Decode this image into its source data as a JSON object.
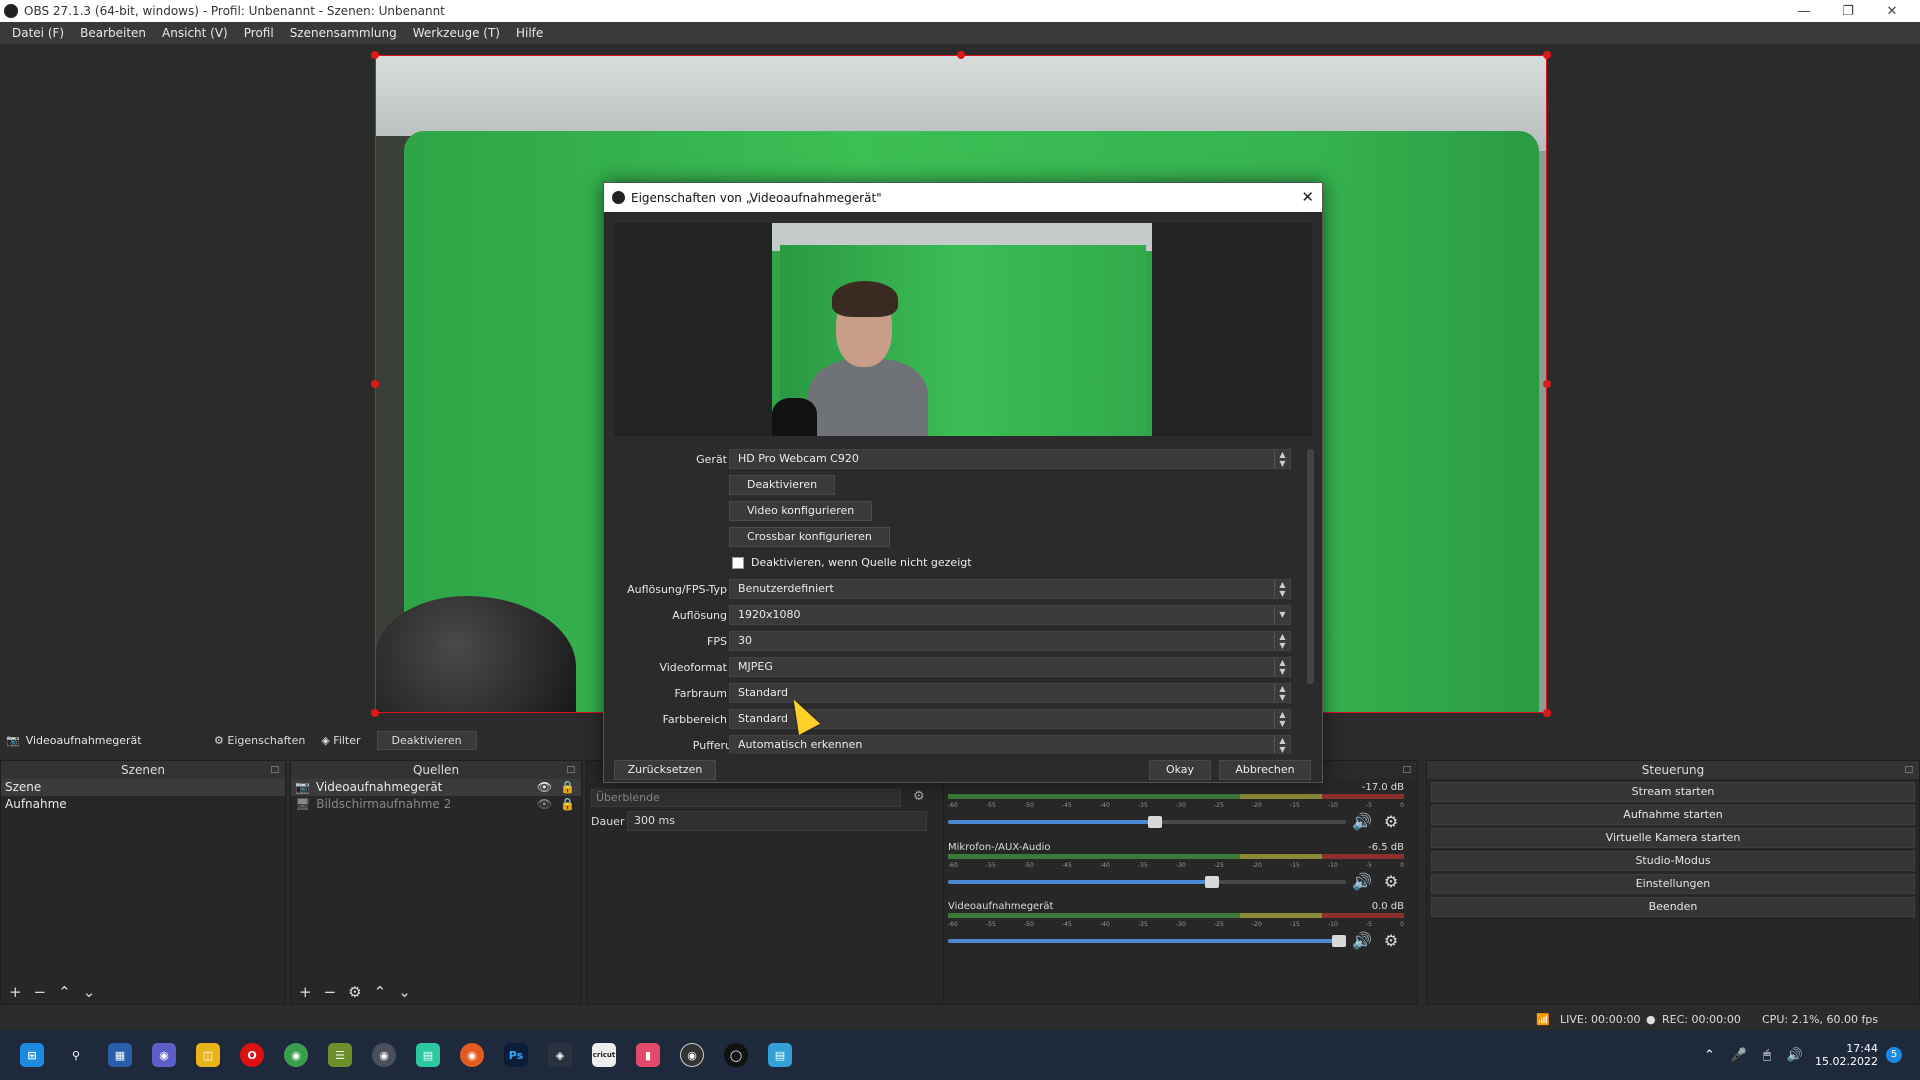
{
  "window": {
    "title": "OBS 27.1.3 (64-bit, windows) - Profil: Unbenannt - Szenen: Unbenannt",
    "min_icon": "minimize-icon",
    "max_icon": "restore-icon",
    "close_icon": "close-icon"
  },
  "menu": [
    "Datei (F)",
    "Bearbeiten",
    "Ansicht (V)",
    "Profil",
    "Szenensammlung",
    "Werkzeuge (T)",
    "Hilfe"
  ],
  "source_toolbar": {
    "source_name": "Videoaufnahmegerät",
    "properties": "Eigenschaften",
    "filter": "Filter",
    "deactivate": "Deaktivieren"
  },
  "scenes": {
    "title": "Szenen",
    "items": [
      "Szene",
      "Aufnahme"
    ]
  },
  "sources": {
    "title": "Quellen",
    "items": [
      "Videoaufnahmegerät",
      "Bildschirmaufnahme 2"
    ]
  },
  "transition": {
    "type": "Überblende",
    "duration_label": "Dauer",
    "duration_value": "300 ms"
  },
  "mixer": {
    "channels": [
      {
        "name": "",
        "db": "-17.0 dB",
        "volume": 0.52
      },
      {
        "name": "Mikrofon-/AUX-Audio",
        "db": "-6.5 dB",
        "volume": 0.67
      },
      {
        "name": "Videoaufnahmegerät",
        "db": "0.0 dB",
        "volume": 1.0
      }
    ],
    "ticks": [
      "-60",
      "-55",
      "-50",
      "-45",
      "-40",
      "-35",
      "-30",
      "-25",
      "-20",
      "-15",
      "-10",
      "-5",
      "0"
    ]
  },
  "controls": {
    "title": "Steuerung",
    "buttons": [
      "Stream starten",
      "Aufnahme starten",
      "Virtuelle Kamera starten",
      "Studio-Modus",
      "Einstellungen",
      "Beenden"
    ]
  },
  "status": {
    "live": "LIVE: 00:00:00",
    "rec": "REC: 00:00:00",
    "cpu": "CPU: 2.1%, 60.00 fps"
  },
  "dialog": {
    "title": "Eigenschaften von „Videoaufnahmegerät\"",
    "fields": {
      "device_label": "Gerät",
      "device_value": "HD Pro Webcam C920",
      "btn_deactivate": "Deaktivieren",
      "btn_video_config": "Video konfigurieren",
      "btn_crossbar_config": "Crossbar konfigurieren",
      "chk_deactivate_hidden": "Deaktivieren, wenn Quelle nicht gezeigt",
      "res_type_label": "Auflösung/FPS-Typ",
      "res_type_value": "Benutzerdefiniert",
      "resolution_label": "Auflösung",
      "resolution_value": "1920x1080",
      "fps_label": "FPS",
      "fps_value": "30",
      "video_format_label": "Videoformat",
      "video_format_value": "MJPEG",
      "color_space_label": "Farbraum",
      "color_space_value": "Standard",
      "color_range_label": "Farbbereich",
      "color_range_value": "Standard",
      "buffering_label": "Pufferung",
      "buffering_value": "Automatisch erkennen"
    },
    "footer": {
      "reset": "Zurücksetzen",
      "ok": "Okay",
      "cancel": "Abbrechen"
    }
  },
  "taskbar": {
    "clock_time": "17:44",
    "clock_date": "15.02.2022",
    "notification_count": "5",
    "apps": [
      "Ps",
      "cricut"
    ]
  }
}
